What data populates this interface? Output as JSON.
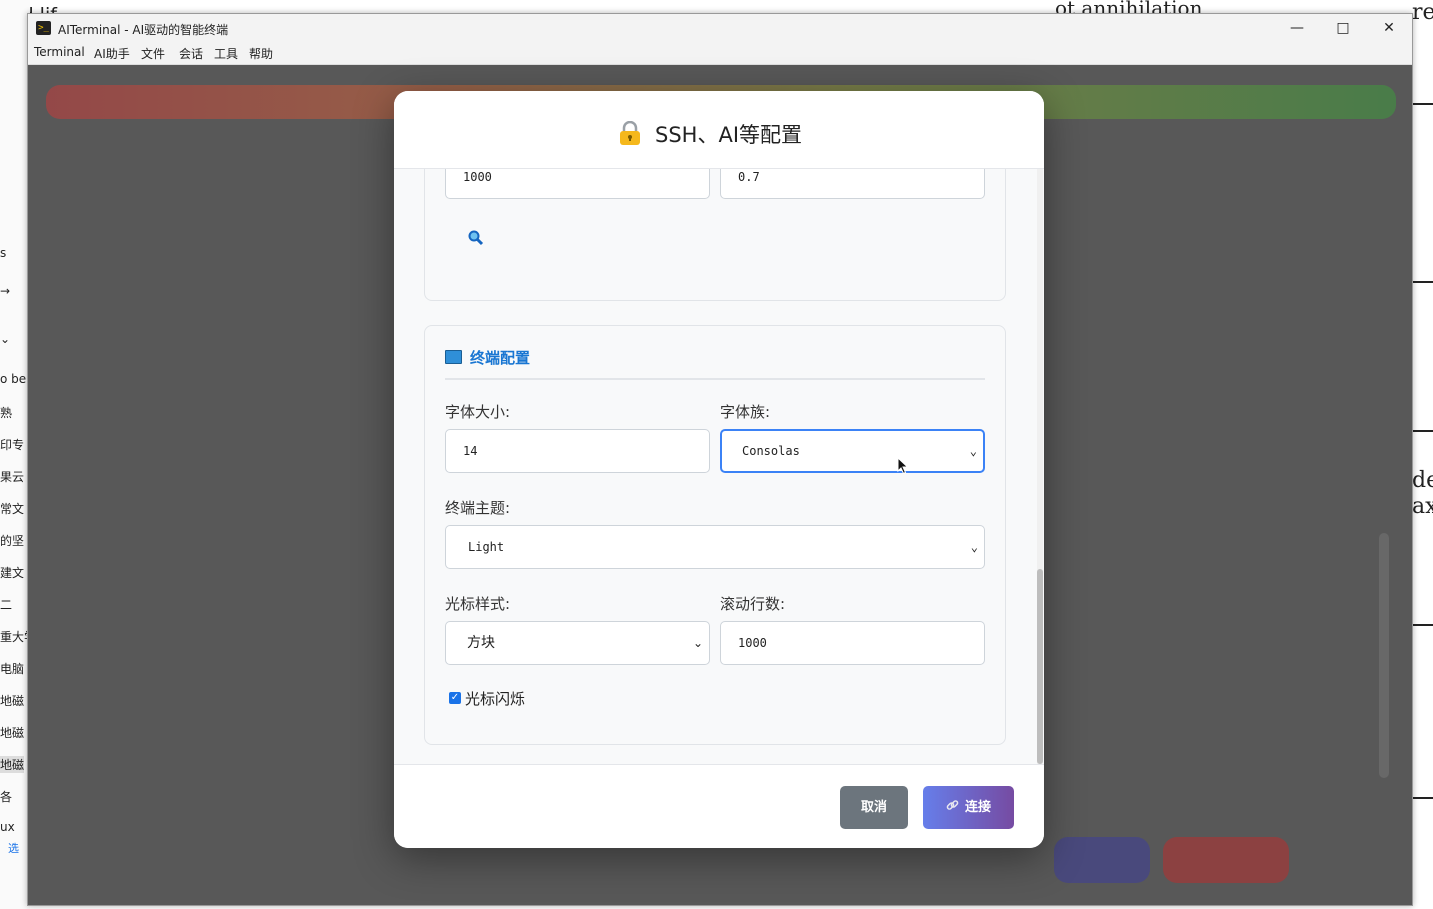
{
  "background_fragments": {
    "top_left": "Hid lif",
    "top_right": "ot annihilation",
    "left_edge": [
      "s",
      "→",
      "⌄",
      "o be",
      "熟",
      "印专",
      "果云",
      "常文",
      "的坚",
      "建文",
      "二",
      "重大学",
      "电脑",
      "地磁",
      "地磁",
      "地磁",
      "各",
      "ux",
      "选"
    ],
    "right_edge": [
      "re",
      "de",
      "ax"
    ]
  },
  "window": {
    "title": "AITerminal - AI驱动的智能终端",
    "controls": {
      "minimize": "—",
      "maximize": "□",
      "close": "✕"
    }
  },
  "menubar": [
    "Terminal",
    "AI助手",
    "文件",
    "会话",
    "工具",
    "帮助"
  ],
  "modal": {
    "title": "SSH、AI等配置",
    "ai_section": {
      "max_tokens_value": "1000",
      "temperature_value": "0.7",
      "test_icon": "magnifier-icon"
    },
    "terminal_section": {
      "title": "终端配置",
      "title_icon": "monitor-icon",
      "font_size_label": "字体大小:",
      "font_size_value": "14",
      "font_family_label": "字体族:",
      "font_family_value": "Consolas",
      "theme_label": "终端主题:",
      "theme_value": "Light",
      "cursor_style_label": "光标样式:",
      "cursor_style_value": "方块",
      "scrollback_label": "滚动行数:",
      "scrollback_value": "1000",
      "cursor_blink_label": "光标闪烁",
      "cursor_blink_checked": true
    },
    "footer": {
      "cancel_label": "取消",
      "connect_label": "连接",
      "connect_icon": "link-icon"
    }
  },
  "colors": {
    "accent": "#1976d2",
    "focus_border": "#3b82f6",
    "cancel_button": "#6c757d",
    "connect_gradient_start": "#667eea",
    "connect_gradient_end": "#764ba2"
  }
}
